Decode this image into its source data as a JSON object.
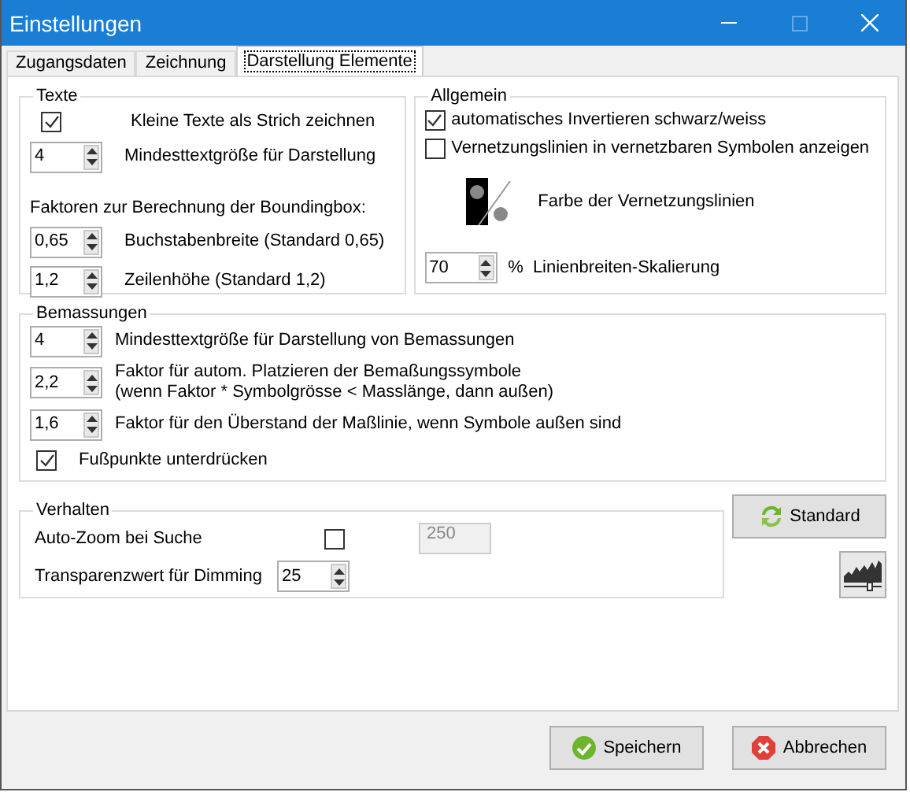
{
  "window": {
    "title": "Einstellungen"
  },
  "tabs": [
    {
      "label": "Zugangsdaten",
      "selected": false
    },
    {
      "label": "Zeichnung",
      "selected": false
    },
    {
      "label": "Darstellung Elemente",
      "selected": true
    }
  ],
  "texte": {
    "title": "Texte",
    "items": [
      {
        "kind": "checkbox",
        "checked": true,
        "label": "Kleine Texte als Strich zeichnen"
      },
      {
        "kind": "spinner",
        "value": "4",
        "label": "Mindesttextgröße für Darstellung"
      },
      {
        "kind": "heading",
        "text": "Faktoren zur Berechnung der Boundingbox:"
      },
      {
        "kind": "spinner",
        "value": "0,65",
        "label": "Buchstabenbreite (Standard 0,65)"
      },
      {
        "kind": "spinner",
        "value": "1,2",
        "label": "Zeilenhöhe (Standard 1,2)"
      }
    ]
  },
  "allgemein": {
    "title": "Allgemein",
    "checkboxes": [
      {
        "label": "automatisches Invertieren schwarz/weiss",
        "checked": true
      },
      {
        "label": "Vernetzungslinien in vernetzbaren Symbolen anzeigen",
        "checked": false
      }
    ],
    "color_label": "Farbe der Vernetzungslinien",
    "scale": {
      "value": "70",
      "unit": "%",
      "label": "Linienbreiten-Skalierung"
    }
  },
  "bemassungen": {
    "title": "Bemassungen",
    "items": [
      {
        "kind": "spinner",
        "value": "4",
        "label": "Mindesttextgröße für Darstellung von Bemassungen"
      },
      {
        "kind": "spinner",
        "value": "2,2",
        "label": "Faktor für autom. Platzieren der Bemaßungssymbole",
        "note": "(wenn Faktor * Symbolgrösse < Masslänge, dann außen)"
      },
      {
        "kind": "spinner",
        "value": "1,6",
        "label": "Faktor für den Überstand der Maßlinie, wenn Symbole außen sind"
      }
    ],
    "checkbox": {
      "checked": true,
      "label": "Fußpunkte unterdrücken"
    }
  },
  "verhalten": {
    "title": "Verhalten",
    "auto_zoom": {
      "label": "Auto-Zoom bei Suche",
      "checked": false,
      "value": "250",
      "disabled": true
    },
    "dimming": {
      "label": "Transparenzwert für Dimming",
      "value": "25"
    }
  },
  "standard_button": {
    "label": "Standard"
  },
  "buttons": [
    {
      "kind": "save",
      "label": "Speichern"
    },
    {
      "kind": "cancel",
      "label": "Abbrechen"
    }
  ]
}
